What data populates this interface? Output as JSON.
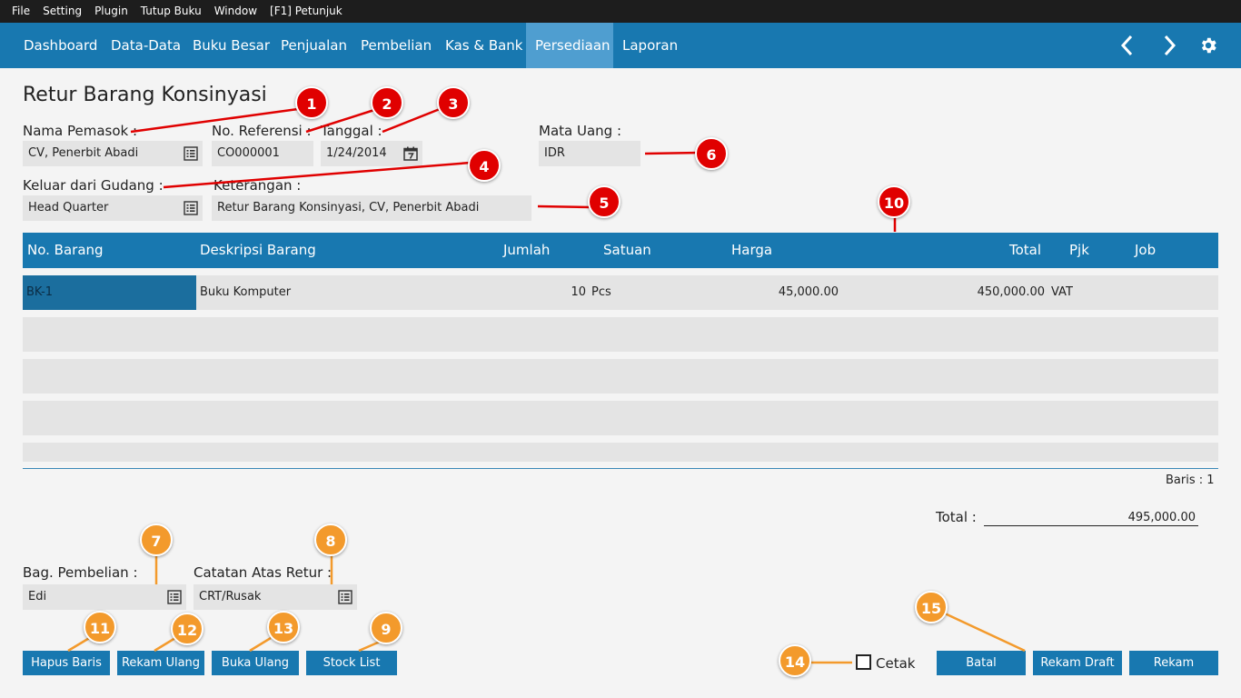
{
  "menubar": [
    "File",
    "Setting",
    "Plugin",
    "Tutup Buku",
    "Window",
    "[F1] Petunjuk"
  ],
  "navbar": {
    "tabs": [
      "Dashboard",
      "Data-Data",
      "Buku Besar",
      "Penjualan",
      "Pembelian",
      "Kas & Bank",
      "Persediaan",
      "Laporan"
    ],
    "active_tab": "Persediaan",
    "icons": [
      "chevron-left-icon",
      "chevron-right-icon",
      "gear-icon"
    ]
  },
  "form": {
    "title": "Retur Barang Konsinyasi",
    "supplier_label": "Nama Pemasok :",
    "supplier_value": "CV, Penerbit Abadi",
    "reference_label": "No. Referensi :",
    "reference_value": "CO000001",
    "date_label": "Tanggal :",
    "date_value": "1/24/2014",
    "currency_label": "Mata Uang :",
    "currency_value": "IDR",
    "warehouse_label": "Keluar dari Gudang :",
    "warehouse_value": "Head Quarter",
    "notes_label": "Keterangan :",
    "notes_value": "Retur Barang Konsinyasi, CV, Penerbit Abadi"
  },
  "table": {
    "columns": [
      "No. Barang",
      "Deskripsi Barang",
      "Jumlah",
      "Satuan",
      "Harga",
      "Total",
      "Pjk",
      "Job"
    ],
    "rows": [
      {
        "item_no": "BK-1",
        "description": "Buku Komputer",
        "qty": "10",
        "unit": "Pcs",
        "price": "45,000.00",
        "total": "450,000.00",
        "tax": "VAT",
        "job": ""
      }
    ],
    "row_count_text": "Baris : 1"
  },
  "summary": {
    "total_label": "Total :",
    "total_value": "495,000.00"
  },
  "footer": {
    "purchasing_label": "Bag. Pembelian :",
    "purchasing_value": "Edi",
    "return_note_label": "Catatan Atas Retur :",
    "return_note_value": "CRT/Rusak",
    "print_label": "Cetak"
  },
  "buttons": {
    "delete_row": "Hapus Baris",
    "re_record": "Rekam Ulang",
    "reopen": "Buka Ulang",
    "stock_list": "Stock List",
    "cancel": "Batal",
    "save_draft": "Rekam Draft",
    "save": "Rekam"
  },
  "callouts": [
    "1",
    "2",
    "3",
    "4",
    "5",
    "6",
    "7",
    "8",
    "9",
    "10",
    "11",
    "12",
    "13",
    "14",
    "15"
  ],
  "colors": {
    "nav_bg": "#1878b0",
    "nav_active": "#4f9ed0",
    "callout_red": "#e00000",
    "callout_orange": "#f39a2c",
    "selected_cell": "#1b6e9e"
  }
}
